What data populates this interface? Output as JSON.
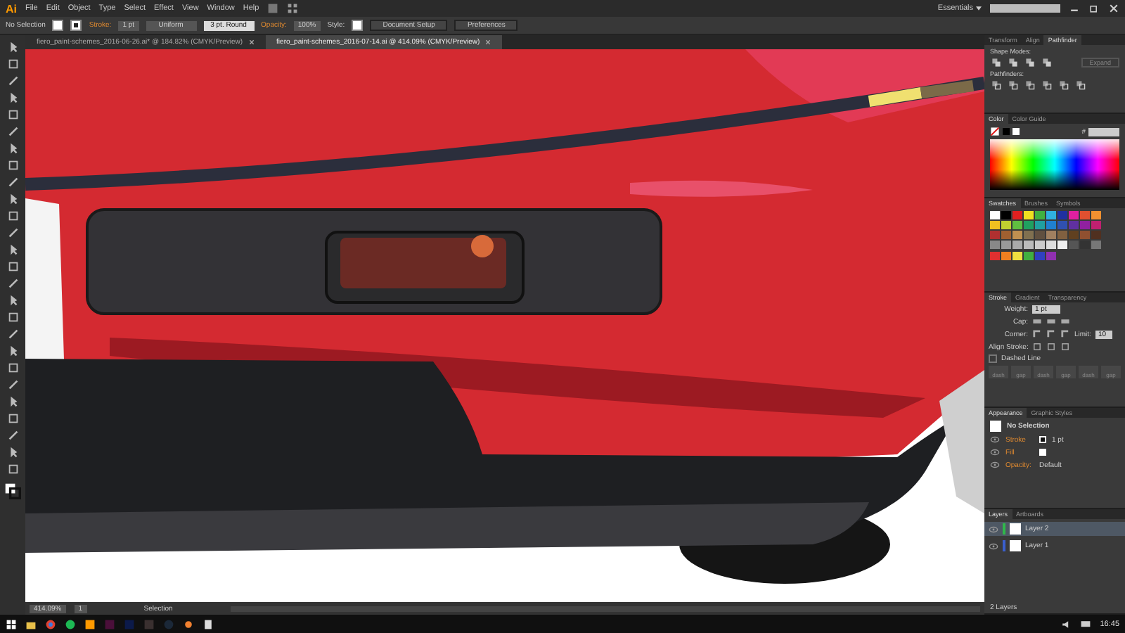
{
  "menu_bar": {
    "logo": "Ai",
    "menus": [
      "File",
      "Edit",
      "Object",
      "Type",
      "Select",
      "Effect",
      "View",
      "Window",
      "Help"
    ],
    "workspace": "Essentials"
  },
  "control_bar": {
    "selection": "No Selection",
    "stroke_label": "Stroke:",
    "stroke_weight": "1 pt",
    "profile": "Uniform",
    "brush": "3 pt. Round",
    "opacity_label": "Opacity:",
    "opacity": "100%",
    "style_label": "Style:",
    "buttons": [
      "Document Setup",
      "Preferences"
    ]
  },
  "document_tabs": [
    {
      "label": "fiero_paint-schemes_2016-06-26.ai* @ 184.82% (CMYK/Preview)",
      "selected": false
    },
    {
      "label": "fiero_paint-schemes_2016-07-14.ai @ 414.09% (CMYK/Preview)",
      "selected": true
    }
  ],
  "pathfinder_panel": {
    "tabs": [
      {
        "label": "Transform",
        "selected": false
      },
      {
        "label": "Align",
        "selected": false
      },
      {
        "label": "Pathfinder",
        "selected": true
      }
    ],
    "shape_modes_label": "Shape Modes:",
    "expand_button": "Expand",
    "pathfinders_label": "Pathfinders:"
  },
  "color_panel": {
    "tabs": [
      {
        "label": "Color",
        "selected": true
      },
      {
        "label": "Color Guide",
        "selected": false
      }
    ],
    "hash": "#"
  },
  "swatches_panel": {
    "tabs": [
      {
        "label": "Swatches",
        "selected": true
      },
      {
        "label": "Brushes",
        "selected": false
      },
      {
        "label": "Symbols",
        "selected": false
      }
    ]
  },
  "stroke_panel": {
    "tabs": [
      {
        "label": "Stroke",
        "selected": true
      },
      {
        "label": "Gradient",
        "selected": false
      },
      {
        "label": "Transparency",
        "selected": false
      }
    ],
    "weight_label": "Weight:",
    "weight": "1 pt",
    "cap_label": "Cap:",
    "corner_label": "Corner:",
    "limit_label": "Limit:",
    "limit": "10",
    "align_label": "Align Stroke:",
    "dashed_line": {
      "label": "Dashed Line",
      "checked": false
    },
    "dash_labels": [
      "dash",
      "gap",
      "dash",
      "gap",
      "dash",
      "gap"
    ]
  },
  "appearance_panel": {
    "tabs": [
      {
        "label": "Appearance",
        "selected": true
      },
      {
        "label": "Graphic Styles",
        "selected": false
      }
    ],
    "title": "No Selection",
    "rows": [
      {
        "label": "Stroke",
        "value": "1 pt"
      },
      {
        "label": "Fill",
        "value": ""
      },
      {
        "label": "Opacity:",
        "value": "Default"
      }
    ]
  },
  "layers_panel": {
    "tabs": [
      {
        "label": "Layers",
        "selected": true
      },
      {
        "label": "Artboards",
        "selected": false
      }
    ],
    "layers": [
      {
        "name": "Layer 2",
        "color": "#2fb84a",
        "selected": true
      },
      {
        "name": "Layer 1",
        "color": "#3a5fcd",
        "selected": false
      }
    ],
    "count": "2 Layers"
  },
  "status_bar": {
    "zoom": "414.09%",
    "artboard": "1",
    "tool": "Selection"
  },
  "taskbar": {
    "time": "16:45"
  }
}
